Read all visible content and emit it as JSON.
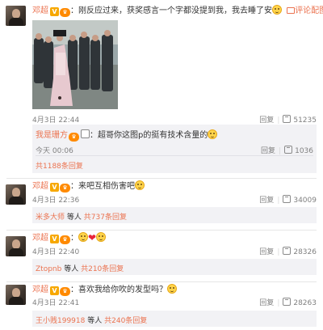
{
  "comments": [
    {
      "username": "邓超",
      "text": "：刚反应过来，获奖感言一个字都没提到我，我去睡了安",
      "view_pic_label": "评论配图",
      "date": "4月3日 22:44",
      "reply_label": "回复",
      "like_count": "51235",
      "sub_reply": {
        "username": "我是珊方",
        "text": "：超哥你这图p的挺有技术含量的",
        "date": "今天 00:06",
        "reply_label": "回复",
        "like_count": "1036"
      },
      "total_replies": "共1188条回复"
    },
    {
      "username": "邓超",
      "text": "：来吧互相伤害吧",
      "date": "4月3日 22:36",
      "reply_label": "回复",
      "like_count": "34009",
      "replier": "米多大师",
      "etc": "等人",
      "total_replies": "共737条回复"
    },
    {
      "username": "邓超",
      "text": "：",
      "date": "4月3日 22:40",
      "reply_label": "回复",
      "like_count": "28326",
      "replier": "Ztopnb",
      "etc": "等人",
      "total_replies": "共210条回复"
    },
    {
      "username": "邓超",
      "text": "：喜欢我给你吹的发型吗？",
      "date": "4月3日 22:41",
      "reply_label": "回复",
      "like_count": "28263",
      "replier": "王小贱199918",
      "etc": "等人",
      "total_replies": "共240条回复"
    }
  ],
  "colors": {
    "username": "#eb7350",
    "meta": "#808080",
    "reply_bg": "#f2f2f5"
  },
  "icons": [
    "avatar",
    "v-badge-icon",
    "level-badge-icon",
    "smile-emoji-icon",
    "heart-emoji-icon",
    "thumb-up-icon"
  ]
}
